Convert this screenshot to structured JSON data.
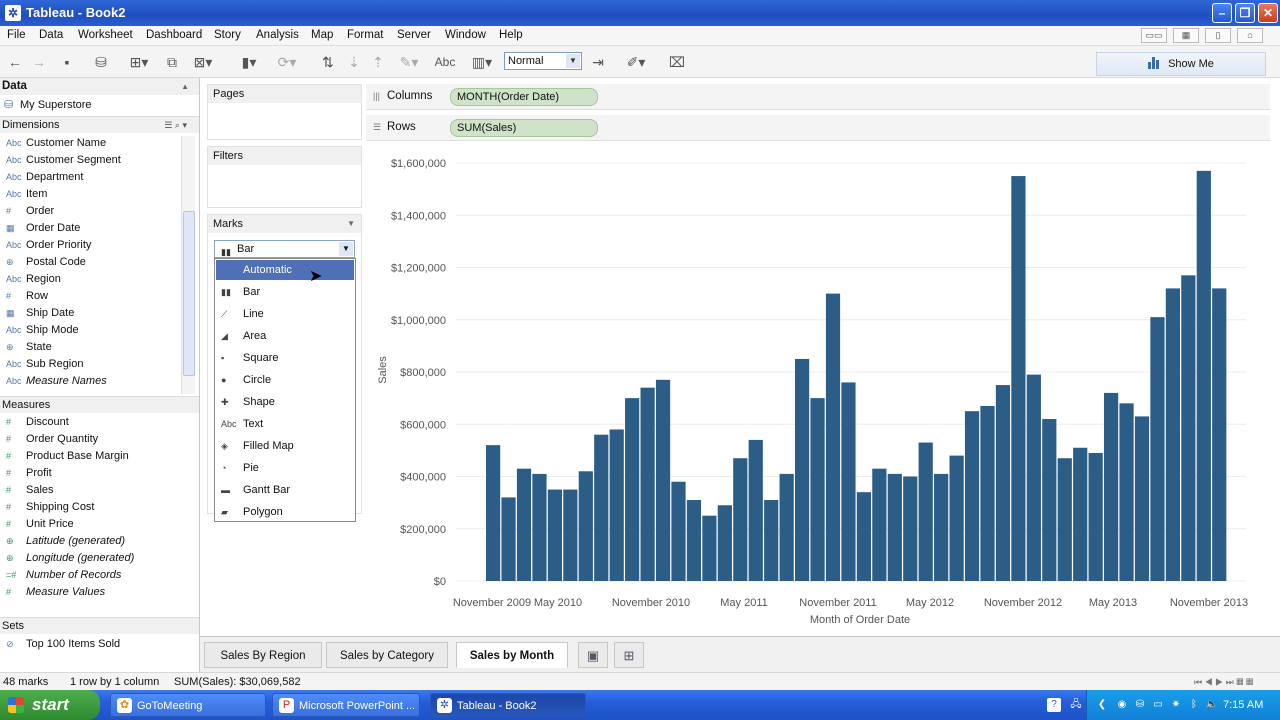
{
  "window": {
    "title": "Tableau - Book2"
  },
  "menu": [
    "File",
    "Data",
    "Worksheet",
    "Dashboard",
    "Story",
    "Analysis",
    "Map",
    "Format",
    "Server",
    "Window",
    "Help"
  ],
  "toolbar": {
    "fit_value": "Normal",
    "show_me_label": "Show Me",
    "abc_label": "Abc"
  },
  "data_pane": {
    "header": "Data",
    "source": "My Superstore",
    "dimensions_header": "Dimensions",
    "dimensions": [
      {
        "type": "Abc",
        "label": "Customer Name"
      },
      {
        "type": "Abc",
        "label": "Customer Segment"
      },
      {
        "type": "Abc",
        "label": "Department"
      },
      {
        "type": "Abc",
        "label": "Item"
      },
      {
        "type": "#",
        "label": "Order"
      },
      {
        "type": "date",
        "label": "Order Date"
      },
      {
        "type": "Abc",
        "label": "Order Priority"
      },
      {
        "type": "geo",
        "label": "Postal Code"
      },
      {
        "type": "Abc",
        "label": "Region"
      },
      {
        "type": "#",
        "label": "Row"
      },
      {
        "type": "date",
        "label": "Ship Date"
      },
      {
        "type": "Abc",
        "label": "Ship Mode"
      },
      {
        "type": "geo",
        "label": "State"
      },
      {
        "type": "Abc",
        "label": "Sub Region"
      },
      {
        "type": "Abc",
        "label": "Measure Names",
        "italic": true
      }
    ],
    "measures_header": "Measures",
    "measures": [
      {
        "type": "#",
        "label": "Discount"
      },
      {
        "type": "#",
        "label": "Order Quantity"
      },
      {
        "type": "#",
        "label": "Product Base Margin"
      },
      {
        "type": "#",
        "label": "Profit"
      },
      {
        "type": "#",
        "label": "Sales"
      },
      {
        "type": "#",
        "label": "Shipping Cost"
      },
      {
        "type": "#",
        "label": "Unit Price"
      },
      {
        "type": "geo",
        "label": "Latitude (generated)",
        "italic": true
      },
      {
        "type": "geo",
        "label": "Longitude (generated)",
        "italic": true
      },
      {
        "type": "=#",
        "label": "Number of Records",
        "italic": true
      },
      {
        "type": "#",
        "label": "Measure Values",
        "italic": true
      }
    ],
    "sets_header": "Sets",
    "sets": [
      {
        "label": "Top 100 Items Sold"
      }
    ]
  },
  "cards": {
    "pages": "Pages",
    "filters": "Filters",
    "marks": "Marks"
  },
  "marks": {
    "type_value": "Bar",
    "options": [
      "Automatic",
      "Bar",
      "Line",
      "Area",
      "Square",
      "Circle",
      "Shape",
      "Text",
      "Filled Map",
      "Pie",
      "Gantt Bar",
      "Polygon"
    ],
    "selected": "Automatic",
    "option_icons": [
      "",
      "bar-icon",
      "line-icon",
      "area-icon",
      "square-icon",
      "circle-icon",
      "shape-icon",
      "text-icon",
      "filled-map-icon",
      "pie-icon",
      "gantt-bar-icon",
      "polygon-icon"
    ]
  },
  "shelves": {
    "columns_label": "Columns",
    "columns_pill": "MONTH(Order Date)",
    "rows_label": "Rows",
    "rows_pill": "SUM(Sales)"
  },
  "chart_data": {
    "type": "bar",
    "xlabel": "Month of Order Date",
    "ylabel": "Sales",
    "ylim": [
      0,
      1600000
    ],
    "y_ticks": [
      "$0",
      "$200,000",
      "$400,000",
      "$600,000",
      "$800,000",
      "$1,000,000",
      "$1,200,000",
      "$1,400,000",
      "$1,600,000"
    ],
    "x_tick_labels": [
      "November 2009",
      "May 2010",
      "November 2010",
      "May 2011",
      "November 2011",
      "May 2012",
      "November 2012",
      "May 2013",
      "November 2013"
    ],
    "color": "#2c5d87",
    "values": [
      520000,
      320000,
      430000,
      410000,
      350000,
      350000,
      420000,
      560000,
      580000,
      700000,
      740000,
      770000,
      380000,
      310000,
      250000,
      290000,
      470000,
      540000,
      310000,
      410000,
      850000,
      700000,
      1100000,
      760000,
      340000,
      430000,
      410000,
      400000,
      530000,
      410000,
      480000,
      650000,
      670000,
      750000,
      1550000,
      790000,
      620000,
      470000,
      510000,
      490000,
      720000,
      680000,
      630000,
      1010000,
      1120000,
      1170000,
      1570000,
      1120000
    ]
  },
  "tabs": [
    "Sales By Region",
    "Sales by Category",
    "Sales by Month"
  ],
  "active_tab": "Sales by Month",
  "status": {
    "marks": "48 marks",
    "dims": "1 row by 1 column",
    "sum": "SUM(Sales): $30,069,582"
  },
  "taskbar": {
    "start_label": "start",
    "tasks": [
      "GoToMeeting",
      "Microsoft PowerPoint ...",
      "Tableau - Book2"
    ],
    "time": "7:15 AM"
  }
}
